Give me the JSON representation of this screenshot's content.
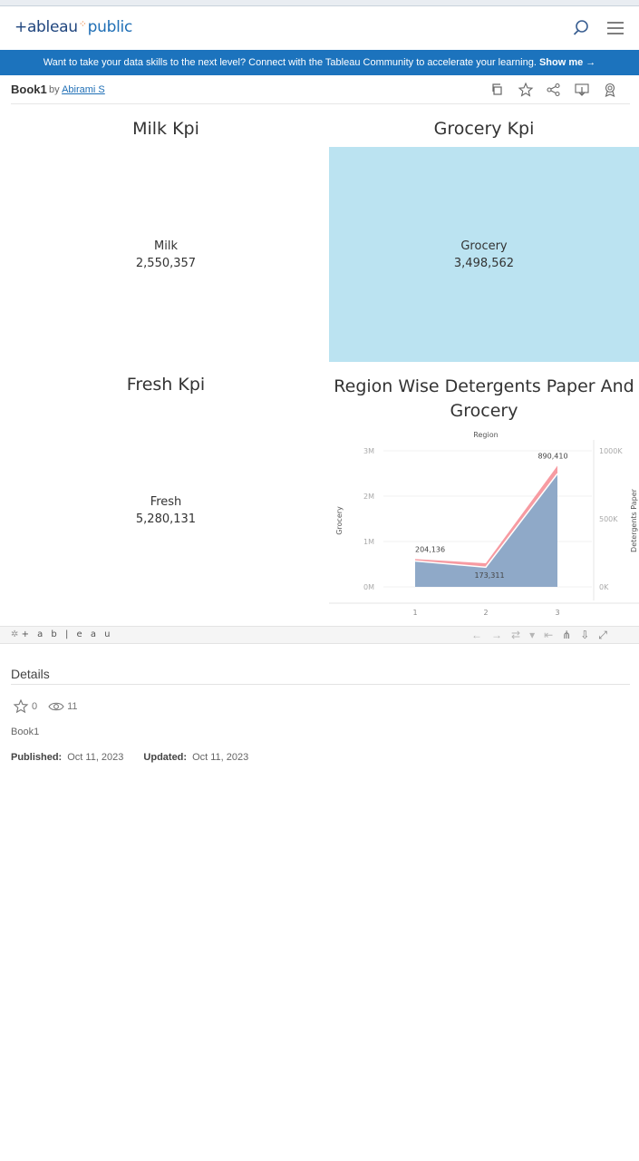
{
  "header": {
    "logo_part1": "+ableau",
    "logo_dots": "⁘",
    "logo_part2": "public"
  },
  "banner": {
    "text": "Want to take your data skills to the next level? Connect with the Tableau Community to accelerate your learning.",
    "cta": "Show me →"
  },
  "workbook": {
    "title": "Book1",
    "by": "by",
    "author": "Abirami S"
  },
  "dashboard": {
    "milk": {
      "title": "Milk Kpi",
      "label": "Milk",
      "value": "2,550,357"
    },
    "grocery": {
      "title": "Grocery Kpi",
      "label": "Grocery",
      "value": "3,498,562",
      "fill": "#bbe3f1"
    },
    "fresh": {
      "title": "Fresh Kpi",
      "label": "Fresh",
      "value": "5,280,131"
    },
    "region_chart_title_line1": "Region Wise Detergents Paper And",
    "region_chart_title_line2": "Grocery"
  },
  "chart_data": {
    "type": "area",
    "title": "Region Wise Detergents Paper And Grocery",
    "xlabel": "Region",
    "ylabel": "Grocery",
    "y2label": "Detergents Paper",
    "x": [
      1,
      2,
      3
    ],
    "ylim": [
      0,
      3000000
    ],
    "y2lim": [
      0,
      1000000
    ],
    "yticks": [
      "0M",
      "1M",
      "2M",
      "3M"
    ],
    "y2ticks": [
      "0K",
      "500K",
      "1000K"
    ],
    "series": [
      {
        "name": "Grocery",
        "axis": "left",
        "values": [
          570000,
          433000,
          2495000
        ],
        "color": "#8fa9c8"
      },
      {
        "name": "Detergents Paper",
        "axis": "right",
        "values": [
          204136,
          173311,
          890410
        ],
        "color": "#f79ba2"
      }
    ],
    "labels": [
      "204,136",
      "173,311",
      "890,410"
    ]
  },
  "toolbar": {
    "logo": "+ a b | e a u",
    "icons": [
      "undo-icon",
      "redo-icon",
      "revert-icon",
      "pause-icon",
      "share-icon",
      "download-icon",
      "fullscreen-icon"
    ]
  },
  "details": {
    "title": "Details",
    "favorites": "0",
    "views": "11",
    "description": "Book1",
    "published_label": "Published:",
    "published_value": "Oct 11, 2023",
    "updated_label": "Updated:",
    "updated_value": "Oct 11, 2023"
  }
}
